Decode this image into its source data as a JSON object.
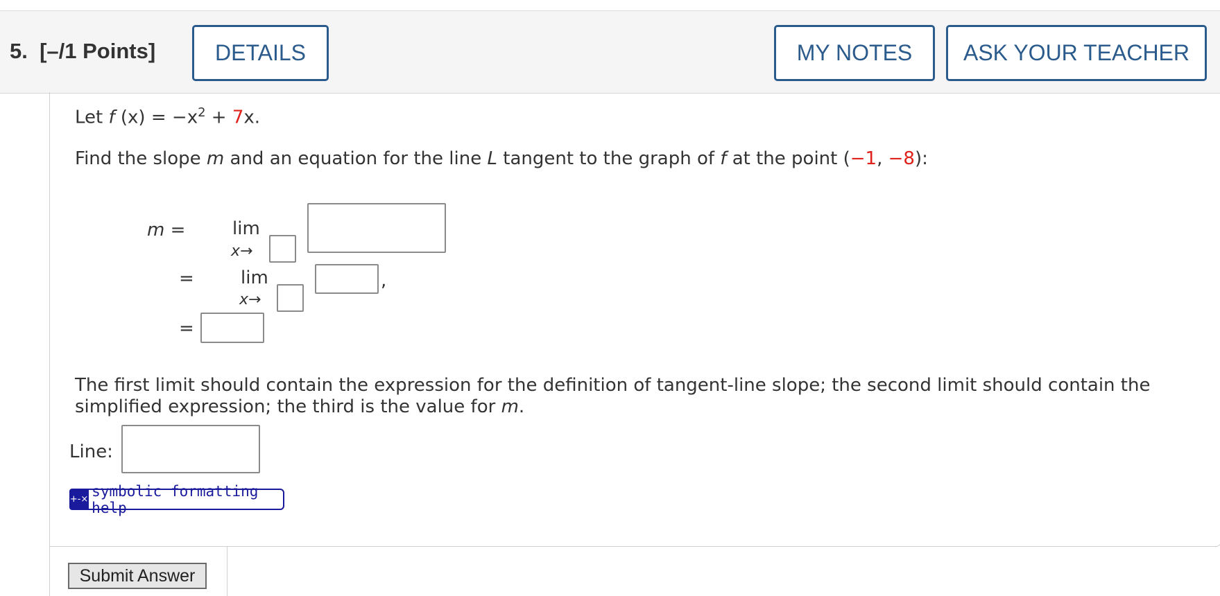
{
  "question": {
    "number_label": "5.",
    "points_label": "[–/1 Points]",
    "details_label": "DETAILS",
    "my_notes_label": "MY NOTES",
    "ask_teacher_label": "ASK YOUR TEACHER"
  },
  "problem": {
    "let_prefix": "Let ",
    "f": "f",
    "fx_arg": " (x)",
    "equals": " = ",
    "neg_x": "−x",
    "exp": "2",
    "plus": " + ",
    "coef": "7",
    "x_dot": "x.",
    "find_prefix": "Find the slope ",
    "m": "m",
    "find_mid": " and an equation for the line ",
    "L": "L",
    "find_mid2": " tangent to the graph of ",
    "f2": "f",
    "find_mid3": " at the point (",
    "pt_x": "−1",
    "comma": ", ",
    "pt_y": "−8",
    "find_end": "):"
  },
  "work": {
    "m_eq": "m =",
    "lim1": "lim",
    "x_arrow1": "x→",
    "eq2": "=",
    "lim2": "lim",
    "x_arrow2": "x→",
    "trailing_comma": ",",
    "eq3": "="
  },
  "instructions": {
    "line1": "The first limit should contain the expression for the definition of tangent-line slope; the second limit should contain the",
    "line2_prefix": "simplified expression; the third is the value for ",
    "line2_m": "m",
    "line2_end": "."
  },
  "line_answer": {
    "label": "Line:"
  },
  "help": {
    "icon_text": "+-×",
    "label": "symbolic formatting help"
  },
  "submit": {
    "label": "Submit Answer"
  },
  "colors": {
    "accent": "#2a5b8c",
    "red_value": "#e0201b",
    "help": "#1a1a9c"
  }
}
